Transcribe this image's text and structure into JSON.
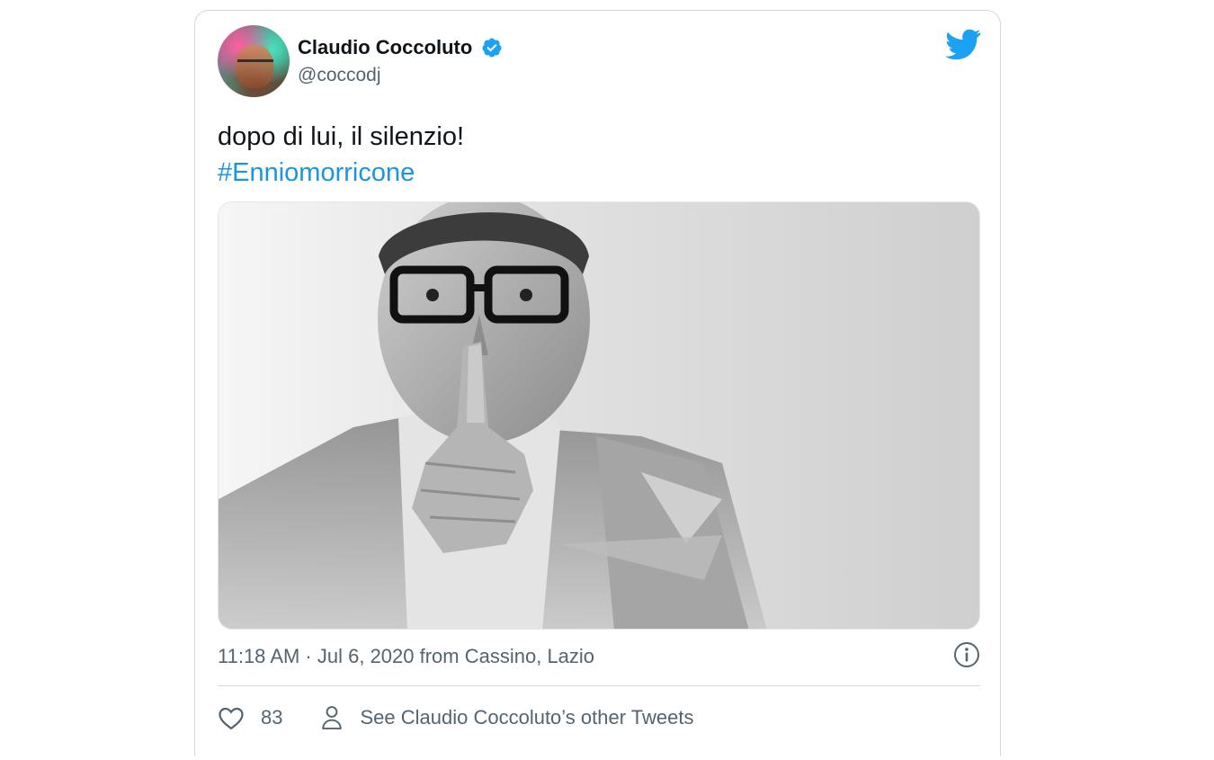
{
  "author": {
    "display_name": "Claudio Coccoluto",
    "handle": "@coccodj",
    "verified": true
  },
  "tweet": {
    "text": "dopo di lui, il silenzio!",
    "hashtag": "#Enniomorricone",
    "timestamp": "11:18 AM · Jul 6, 2020 from Cassino, Lazio"
  },
  "actions": {
    "like_count": "83",
    "other_tweets_label": "See Claudio Coccoluto’s other Tweets"
  },
  "icons": {
    "brand": "twitter-bird-icon",
    "verified": "verified-badge-icon",
    "info": "info-icon",
    "like": "heart-icon",
    "profile": "person-icon"
  },
  "colors": {
    "twitter_blue": "#1da1f2",
    "link_blue": "#1b95e0",
    "text_primary": "#0f1419",
    "text_secondary": "#536471",
    "border": "#cfd9de"
  }
}
